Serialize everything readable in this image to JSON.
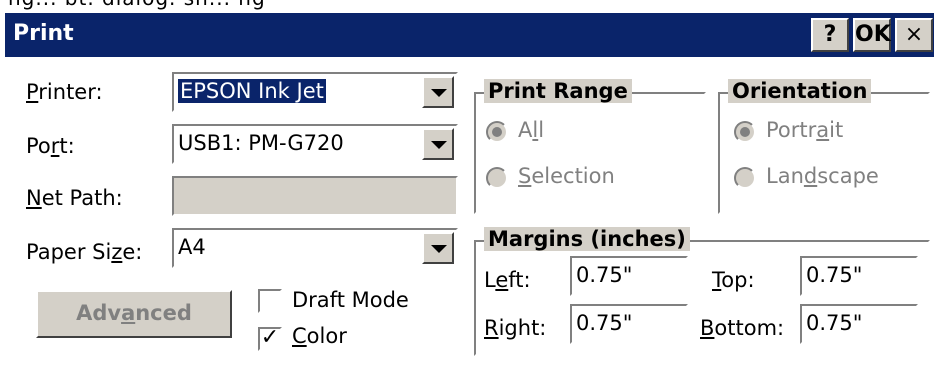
{
  "top_strip_text": "ng... bt. dialog. sn... ng",
  "window": {
    "title": "Print",
    "help_label": "?",
    "ok_label": "OK",
    "close_label": "×"
  },
  "printer": {
    "label_pre": "",
    "label_u": "P",
    "label_post": "rinter:",
    "value": "EPSON Ink Jet"
  },
  "port": {
    "label_pre": "Po",
    "label_u": "r",
    "label_post": "t:",
    "value": "USB1: PM-G720"
  },
  "net_path": {
    "label_pre": "",
    "label_u": "N",
    "label_post": "et Path:",
    "value": ""
  },
  "paper_size": {
    "label_pre": "Paper Si",
    "label_u": "z",
    "label_post": "e:",
    "value": "A4"
  },
  "advanced_button": {
    "label_pre": "Adv",
    "label_u": "a",
    "label_post": "nced"
  },
  "draft_mode": {
    "label": "Draft Mode",
    "checked": false
  },
  "color": {
    "label_u": "C",
    "label_post": "olor",
    "checked": true,
    "check_glyph": "✓"
  },
  "print_range": {
    "title": "Print Range",
    "all": {
      "label_pre": "A",
      "label_u": "l",
      "label_post": "l",
      "selected": true
    },
    "selection": {
      "label_pre": "",
      "label_u": "S",
      "label_post": "election",
      "selected": false
    }
  },
  "orientation": {
    "title": "Orientation",
    "portrait": {
      "label_pre": "Portr",
      "label_u": "a",
      "label_post": "it",
      "selected": true
    },
    "landscape": {
      "label_pre": "Lan",
      "label_u": "d",
      "label_post": "scape",
      "selected": false
    }
  },
  "margins": {
    "title": "Margins (inches)",
    "left": {
      "label_pre": "L",
      "label_u": "e",
      "label_post": "ft:",
      "value": "0.75\""
    },
    "top": {
      "label_pre": "",
      "label_u": "T",
      "label_post": "op:",
      "value": "0.75\""
    },
    "right": {
      "label_pre": "",
      "label_u": "R",
      "label_post": "ight:",
      "value": "0.75\""
    },
    "bottom": {
      "label_pre": "",
      "label_u": "B",
      "label_post": "ottom:",
      "value": "0.75\""
    }
  },
  "colors": {
    "title_bar": "#0a246a",
    "dialog_face": "#d4d0c8",
    "disabled_text": "#808080"
  }
}
